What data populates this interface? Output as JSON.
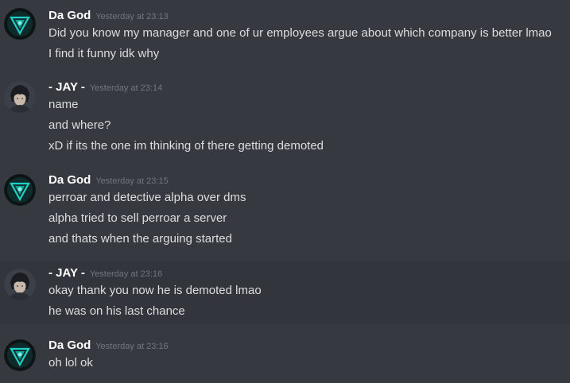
{
  "messages": [
    {
      "username": "Da God",
      "timestamp": "Yesterday at 23:13",
      "avatar": "green-triangle-logo-icon",
      "lines": [
        "Did you know my manager and one of ur employees argue about which company is better lmao",
        "I find it funny idk why"
      ]
    },
    {
      "username": "- JAY -",
      "timestamp": "Yesterday at 23:14",
      "avatar": "anime-character-icon",
      "lines": [
        "name",
        "and where?",
        "xD if its the one im thinking of there getting demoted"
      ]
    },
    {
      "username": "Da God",
      "timestamp": "Yesterday at 23:15",
      "avatar": "green-triangle-logo-icon",
      "lines": [
        "perroar and detective alpha over dms",
        "alpha tried to sell perroar a server",
        "and thats when the arguing started"
      ]
    },
    {
      "username": "- JAY -",
      "timestamp": "Yesterday at 23:16",
      "avatar": "anime-character-icon",
      "lines": [
        "okay thank you now he is demoted lmao",
        "he was on his last chance"
      ]
    },
    {
      "username": "Da God",
      "timestamp": "Yesterday at 23:16",
      "avatar": "green-triangle-logo-icon",
      "lines": [
        "oh lol ok"
      ]
    }
  ],
  "colors": {
    "background": "#36393f",
    "username": "#ffffff",
    "timestamp": "#72767d",
    "message_text": "#dcddde",
    "logo_accent": "#1fd1c4"
  }
}
